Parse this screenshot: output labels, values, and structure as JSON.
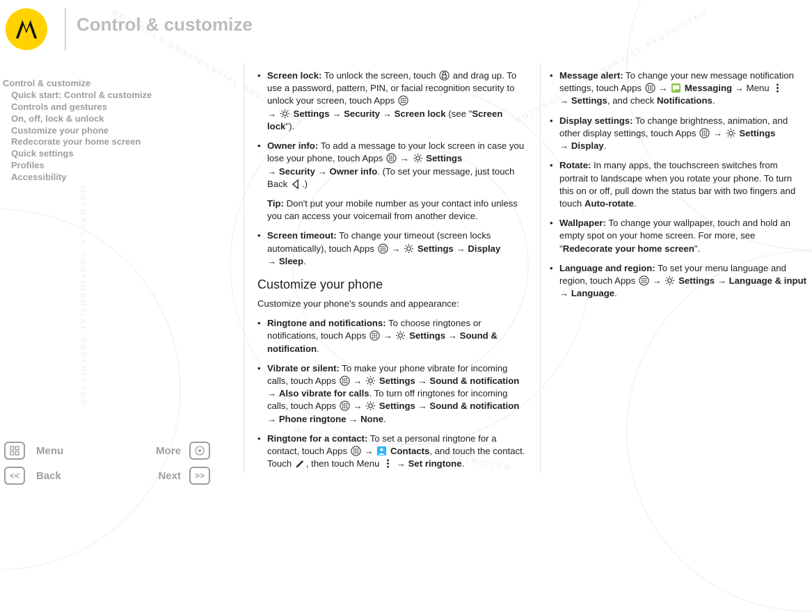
{
  "page_title": "Control & customize",
  "sidebar": {
    "items": [
      {
        "label": "Control & customize",
        "level": 0
      },
      {
        "label": "Quick start: Control & customize",
        "level": 1
      },
      {
        "label": "Controls and gestures",
        "level": 1
      },
      {
        "label": "On, off, lock & unlock",
        "level": 1
      },
      {
        "label": "Customize your phone",
        "level": 1
      },
      {
        "label": "Redecorate your home screen",
        "level": 1
      },
      {
        "label": "Quick settings",
        "level": 1
      },
      {
        "label": "Profiles",
        "level": 1
      },
      {
        "label": "Accessibility",
        "level": 1
      }
    ]
  },
  "nav": {
    "menu": "Menu",
    "more": "More",
    "back": "Back",
    "next": "Next"
  },
  "col1": {
    "screen_lock": {
      "title": "Screen lock:",
      "t1": " To unlock the screen, touch ",
      "t2": " and drag up. To use a password, pattern, PIN, or facial recognition security to unlock your screen, touch Apps ",
      "p2a": " ",
      "p2_settings": "Settings",
      "p2_security": "Security",
      "p2_screenlock": "Screen lock",
      "p2b": " (see \"",
      "p2_link": "Screen lock",
      "p2c": "\")."
    },
    "owner": {
      "title": "Owner info:",
      "t1": " To add a message to your lock screen in case you lose your phone, touch Apps ",
      "p_settings": "Settings",
      "p_security": "Security",
      "p_owner": "Owner info",
      "t2": ". (To set your message, just touch Back ",
      "t3": ".)"
    },
    "tip": {
      "title": "Tip:",
      "body": " Don't put your mobile number as your contact info unless you can access your voicemail from another device."
    },
    "timeout": {
      "title": "Screen timeout:",
      "t1": " To change your timeout (screen locks automatically), touch Apps ",
      "p_settings": "Settings",
      "p_display": "Display",
      "p_sleep": "Sleep",
      "t2": "."
    },
    "h2": "Customize your phone",
    "lead": "Customize your phone's sounds and appearance:",
    "ringnote": {
      "title": "Ringtone and notifications:",
      "t1": " To choose ringtones or notifications, touch Apps ",
      "p_settings": "Settings",
      "p_sound": "Sound & notification",
      "t2": "."
    },
    "vibrate": {
      "title": "Vibrate or silent:",
      "t1": " To make your phone vibrate for incoming calls, touch Apps ",
      "p_settings": "Settings",
      "p_sound": "Sound & notification",
      "p_also": "Also vibrate for calls",
      "t2": ". To turn off ringtones for incoming calls, touch Apps ",
      "p_settings2": "Settings",
      "p_sound2": "Sound & notification",
      "p_ringtone": "Phone ringtone",
      "p_none": "None",
      "t3": "."
    },
    "contact_ring": {
      "title": "Ringtone for a contact:",
      "t1": " To set a personal ringtone for a contact, touch Apps ",
      "p_contacts": "Contacts",
      "t2": ", and touch the contact. Touch ",
      "t3": ", then touch Menu ",
      "p_set": "Set ringtone",
      "t4": "."
    }
  },
  "col2": {
    "msg": {
      "title": "Message alert:",
      "t1": " To change your new message notification settings, touch Apps ",
      "p_messaging": "Messaging",
      "t2": " Menu ",
      "p_settings": "Settings",
      "t3": ", and check ",
      "p_notif": "Notifications",
      "t4": "."
    },
    "display": {
      "title": "Display settings:",
      "t1": " To change brightness, animation, and other display settings, touch Apps ",
      "p_settings": "Settings",
      "p_display": "Display",
      "t2": "."
    },
    "rotate": {
      "title": "Rotate:",
      "t1": " In many apps, the touchscreen switches from portrait to landscape when you rotate your phone. To turn this on or off, pull down the status bar with two fingers and touch ",
      "p_auto": "Auto-rotate",
      "t2": "."
    },
    "wallpaper": {
      "title": "Wallpaper:",
      "t1": " To change your wallpaper, touch and hold an empty spot on your home screen. For more, see \"",
      "p_link": "Redecorate your home screen",
      "t2": "\"."
    },
    "lang": {
      "title": "Language and region:",
      "t1": " To set your menu language and region, touch Apps ",
      "p_settings": "Settings",
      "p_lang": "Language & input",
      "p_lang2": "Language",
      "t2": "."
    }
  },
  "watermark": "MOTOROLA CONFIDENTIAL RESTRICTED"
}
